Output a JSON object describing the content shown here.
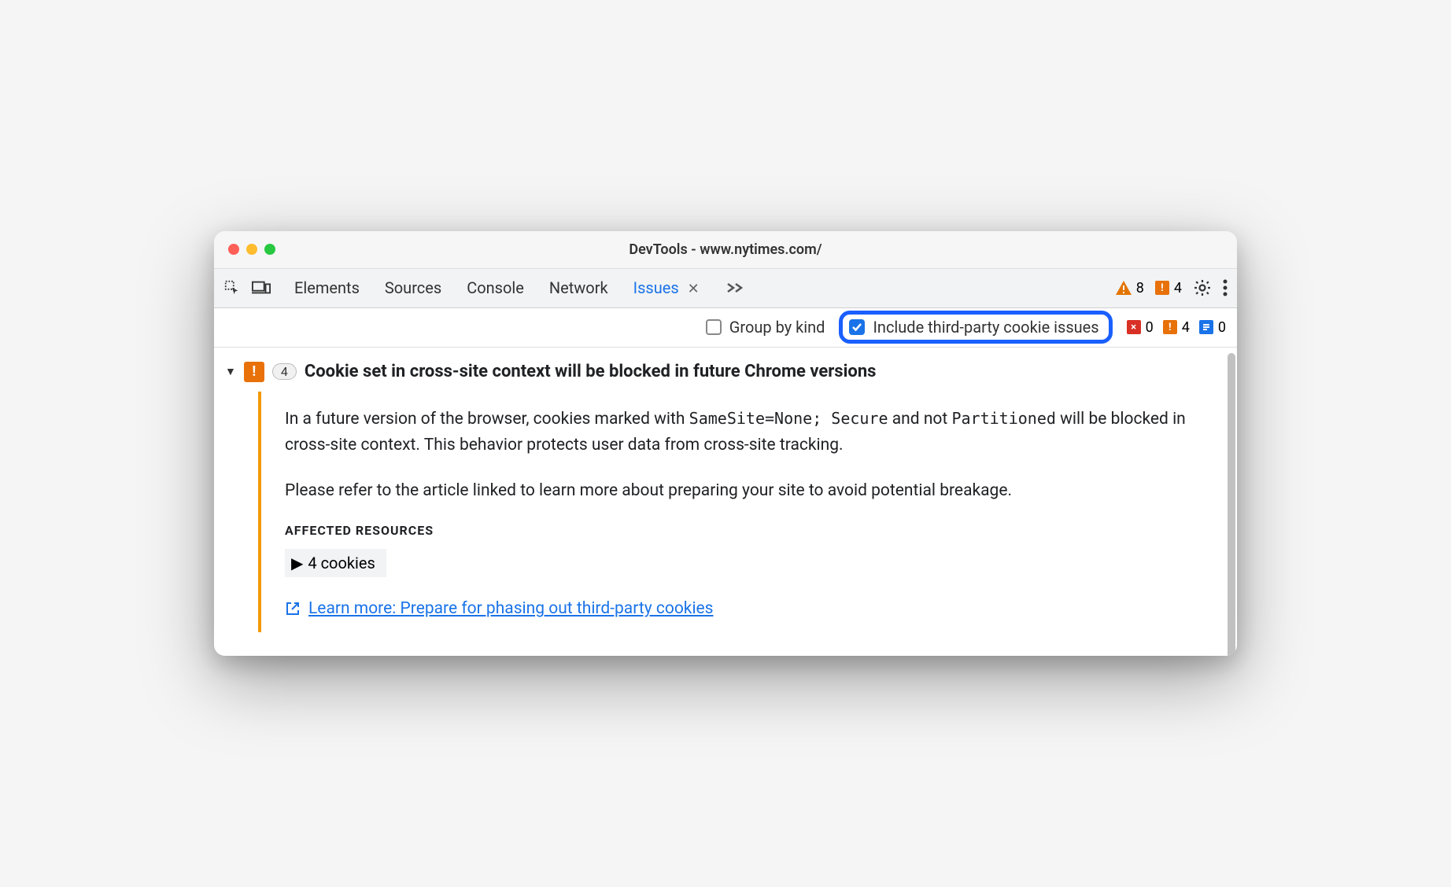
{
  "titlebar": {
    "title": "DevTools - www.nytimes.com/"
  },
  "toolbar": {
    "tabs": [
      {
        "label": "Elements",
        "active": false
      },
      {
        "label": "Sources",
        "active": false
      },
      {
        "label": "Console",
        "active": false
      },
      {
        "label": "Network",
        "active": false
      },
      {
        "label": "Issues",
        "active": true
      }
    ],
    "warning_count": "8",
    "breaking_count": "4"
  },
  "filter": {
    "group_by_kind_label": "Group by kind",
    "include_third_party_label": "Include third-party cookie issues",
    "counts": {
      "errors": "0",
      "warnings": "4",
      "info": "0"
    }
  },
  "issue": {
    "count": "4",
    "title": "Cookie set in cross-site context will be blocked in future Chrome versions",
    "desc_part1": "In a future version of the browser, cookies marked with ",
    "desc_code1": "SameSite=None; Secure",
    "desc_part2": " and not ",
    "desc_code2": "Partitioned",
    "desc_part3": " will be blocked in cross-site context. This behavior protects user data from cross-site tracking.",
    "desc_para2": "Please refer to the article linked to learn more about preparing your site to avoid potential breakage.",
    "affected_heading": "AFFECTED RESOURCES",
    "affected_item": "4 cookies",
    "learn_more_label": "Learn more: Prepare for phasing out third-party cookies"
  }
}
